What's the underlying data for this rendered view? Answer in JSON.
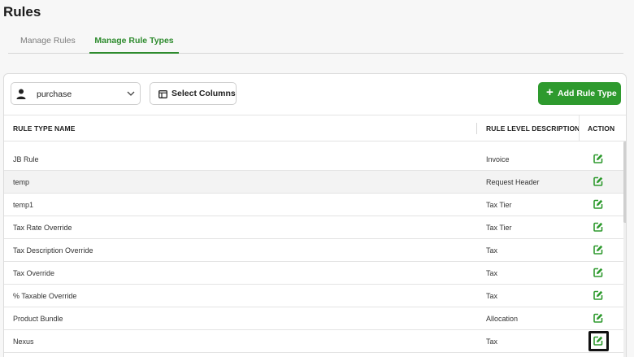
{
  "page": {
    "title": "Rules"
  },
  "tabs": [
    {
      "label": "Manage Rules",
      "active": false
    },
    {
      "label": "Manage Rule Types",
      "active": true
    }
  ],
  "toolbar": {
    "profile_select": {
      "value": "purchase",
      "icon": "person-icon"
    },
    "select_columns_label": "Select Columns",
    "add_button": {
      "plus": "+",
      "label": "Add Rule Type"
    }
  },
  "table": {
    "columns": [
      "RULE TYPE NAME",
      "RULE LEVEL DESCRIPTION",
      "ACTION"
    ],
    "rows": [
      {
        "name": "JB Rule",
        "level": "Invoice"
      },
      {
        "name": "temp",
        "level": "Request Header"
      },
      {
        "name": "temp1",
        "level": "Tax Tier"
      },
      {
        "name": "Tax Rate Override",
        "level": "Tax Tier"
      },
      {
        "name": "Tax Description Override",
        "level": "Tax"
      },
      {
        "name": "Tax Override",
        "level": "Tax"
      },
      {
        "name": "% Taxable Override",
        "level": "Tax"
      },
      {
        "name": "Product Bundle",
        "level": "Allocation"
      },
      {
        "name": "Nexus",
        "level": "Tax"
      }
    ]
  },
  "colors": {
    "accent": "#2e9a2e",
    "edit_icon": "#2e9a2e"
  }
}
